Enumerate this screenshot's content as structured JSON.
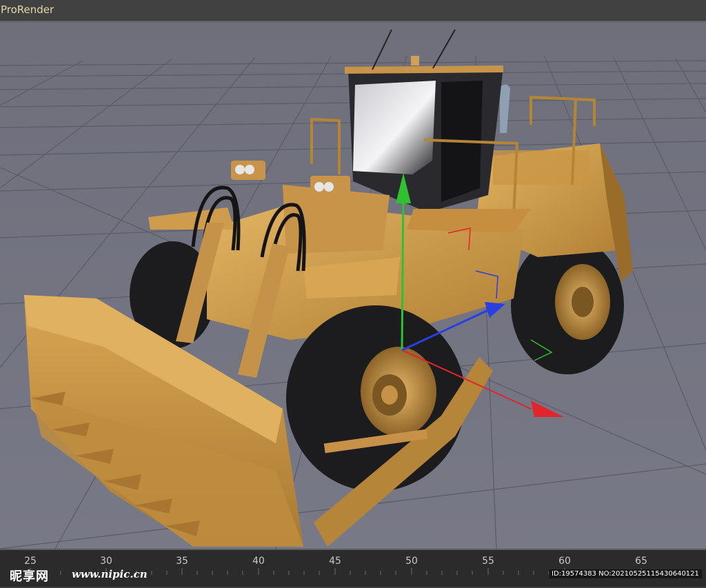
{
  "window": {
    "title": "ProRender"
  },
  "viewport": {
    "background_color": "#72737f",
    "grid_color": "#5a5b66",
    "scene_object": "wheel-loader-dozer-model",
    "gizmo_colors": {
      "x_axis": "#e0262c",
      "y_axis": "#2fc12f",
      "z_axis": "#2a3fe0"
    },
    "body_color": "#d6a24e",
    "tire_color": "#1c1c1e"
  },
  "timeline": {
    "ticks": [
      "25",
      "30",
      "35",
      "40",
      "45",
      "50",
      "55",
      "60",
      "65"
    ]
  },
  "watermark": {
    "logo": "昵享网",
    "url": "www.nipic.cn",
    "id": "ID:19574383 NO:20210525115430640121"
  }
}
